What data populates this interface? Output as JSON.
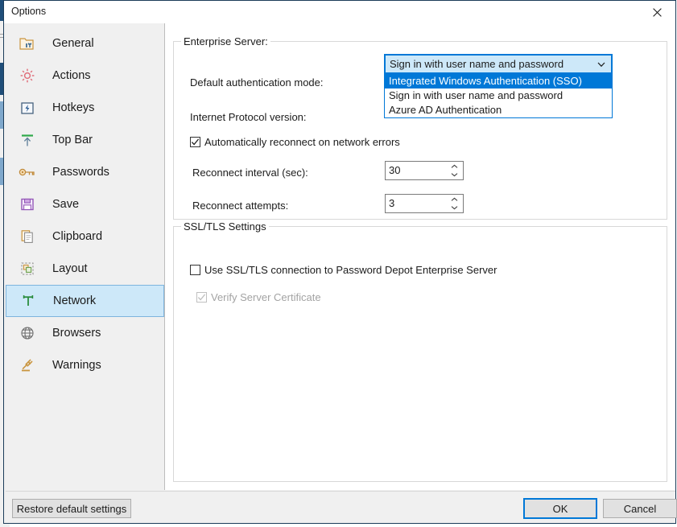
{
  "window": {
    "title": "Options",
    "close_icon": "close-icon"
  },
  "sidebar": {
    "items": [
      {
        "label": "General",
        "icon": "folder-tools-icon",
        "selected": false
      },
      {
        "label": "Actions",
        "icon": "gear-icon",
        "selected": false
      },
      {
        "label": "Hotkeys",
        "icon": "lightning-key-icon",
        "selected": false
      },
      {
        "label": "Top Bar",
        "icon": "arrow-up-bar-icon",
        "selected": false
      },
      {
        "label": "Passwords",
        "icon": "key-icon",
        "selected": false
      },
      {
        "label": "Save",
        "icon": "floppy-disk-icon",
        "selected": false
      },
      {
        "label": "Clipboard",
        "icon": "clipboard-icon",
        "selected": false
      },
      {
        "label": "Layout",
        "icon": "layout-icon",
        "selected": false
      },
      {
        "label": "Network",
        "icon": "network-icon",
        "selected": true
      },
      {
        "label": "Browsers",
        "icon": "globe-icon",
        "selected": false
      },
      {
        "label": "Warnings",
        "icon": "gavel-icon",
        "selected": false
      }
    ]
  },
  "main": {
    "enterprise_group": {
      "legend": "Enterprise Server:",
      "auth_mode_label": "Default authentication mode:",
      "ip_version_label": "Internet Protocol version:",
      "auth_mode_value": "Sign in with user name and password",
      "auth_mode_options": [
        "Integrated Windows Authentication (SSO)",
        "Sign in with user name and password",
        "Azure AD Authentication"
      ],
      "auth_mode_highlighted_index": 0,
      "auto_reconnect_label": "Automatically reconnect on network errors",
      "auto_reconnect_checked": true,
      "reconnect_interval_label": "Reconnect interval (sec):",
      "reconnect_interval_value": "30",
      "reconnect_attempts_label": "Reconnect attempts:",
      "reconnect_attempts_value": "3"
    },
    "ssl_group": {
      "legend": "SSL/TLS Settings",
      "use_ssl_label": "Use SSL/TLS connection to Password Depot Enterprise Server",
      "use_ssl_checked": false,
      "verify_cert_label": "Verify Server Certificate",
      "verify_cert_checked": true,
      "verify_cert_disabled": true
    }
  },
  "footer": {
    "restore_label": "Restore default settings",
    "ok_label": "OK",
    "cancel_label": "Cancel"
  },
  "colors": {
    "accent": "#0078d7",
    "selection_fill": "#cde8f9",
    "window_border": "#1b3c59",
    "chrome": "#f0f0f0"
  }
}
